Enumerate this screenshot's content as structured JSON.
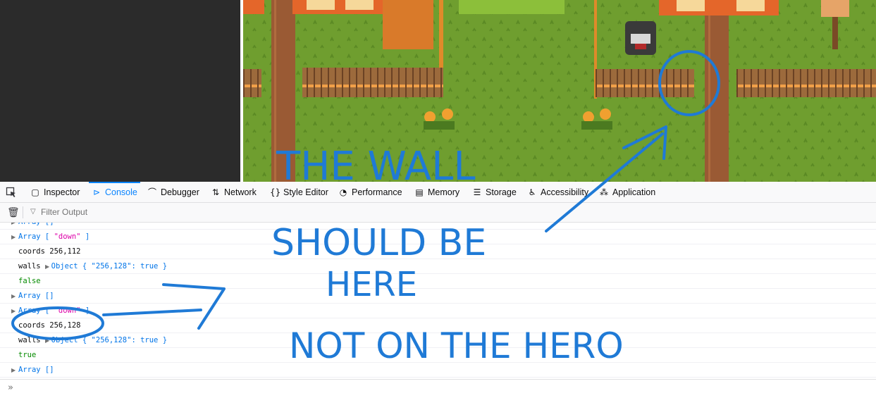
{
  "colors": {
    "grass": "#6f9e2f",
    "fence": "#9c6a3c",
    "path": "#9a5a34",
    "accent": "#0a84ff",
    "annotation": "#1f7ad6"
  },
  "toolbar": {
    "picker_icon": "element-picker-icon",
    "tabs": [
      {
        "label": "Inspector",
        "icon": "inspector-icon"
      },
      {
        "label": "Console",
        "icon": "console-icon"
      },
      {
        "label": "Debugger",
        "icon": "debugger-icon"
      },
      {
        "label": "Network",
        "icon": "network-icon"
      },
      {
        "label": "Style Editor",
        "icon": "style-editor-icon"
      },
      {
        "label": "Performance",
        "icon": "performance-icon"
      },
      {
        "label": "Memory",
        "icon": "memory-icon"
      },
      {
        "label": "Storage",
        "icon": "storage-icon"
      },
      {
        "label": "Accessibility",
        "icon": "accessibility-icon"
      },
      {
        "label": "Application",
        "icon": "application-icon"
      }
    ],
    "active_tab": "Console"
  },
  "filter": {
    "placeholder": "Filter Output",
    "value": ""
  },
  "console": {
    "rows": [
      {
        "arrow": true,
        "parts": [
          {
            "t": "Array []",
            "c": "blue"
          }
        ]
      },
      {
        "arrow": true,
        "parts": [
          {
            "t": "Array [ ",
            "c": "blue"
          },
          {
            "t": "\"down\"",
            "c": "mag"
          },
          {
            "t": " ]",
            "c": "blue"
          }
        ]
      },
      {
        "arrow": false,
        "parts": [
          {
            "t": "coords 256,112",
            "c": "black"
          }
        ]
      },
      {
        "arrow": false,
        "parts": [
          {
            "t": "walls ",
            "c": "black"
          },
          {
            "t": "▶ ",
            "c": "tw"
          },
          {
            "t": "Object { ",
            "c": "blue"
          },
          {
            "t": "\"256,128\"",
            "c": "blue"
          },
          {
            "t": ": true }",
            "c": "blue"
          }
        ]
      },
      {
        "arrow": false,
        "parts": [
          {
            "t": "false",
            "c": "green"
          }
        ]
      },
      {
        "arrow": true,
        "parts": [
          {
            "t": "Array []",
            "c": "blue"
          }
        ]
      },
      {
        "arrow": true,
        "parts": [
          {
            "t": "Array [ ",
            "c": "blue"
          },
          {
            "t": "\"down\"",
            "c": "mag"
          },
          {
            "t": " ]",
            "c": "blue"
          }
        ]
      },
      {
        "arrow": false,
        "parts": [
          {
            "t": "coords 256,128",
            "c": "black"
          }
        ]
      },
      {
        "arrow": false,
        "parts": [
          {
            "t": "walls ",
            "c": "black"
          },
          {
            "t": "▶ ",
            "c": "tw"
          },
          {
            "t": "Object { ",
            "c": "blue"
          },
          {
            "t": "\"256,128\"",
            "c": "blue"
          },
          {
            "t": ": true }",
            "c": "blue"
          }
        ]
      },
      {
        "arrow": false,
        "parts": [
          {
            "t": "true",
            "c": "green"
          }
        ]
      },
      {
        "arrow": true,
        "parts": [
          {
            "t": "Array []",
            "c": "blue"
          }
        ]
      }
    ]
  },
  "prompt_icon": "chevron-double-right-icon",
  "annotations": {
    "line1": "THE WALL",
    "line2": "SHOULD  BE",
    "line3": "HERE",
    "line4": "NOT ON THE HERO"
  }
}
